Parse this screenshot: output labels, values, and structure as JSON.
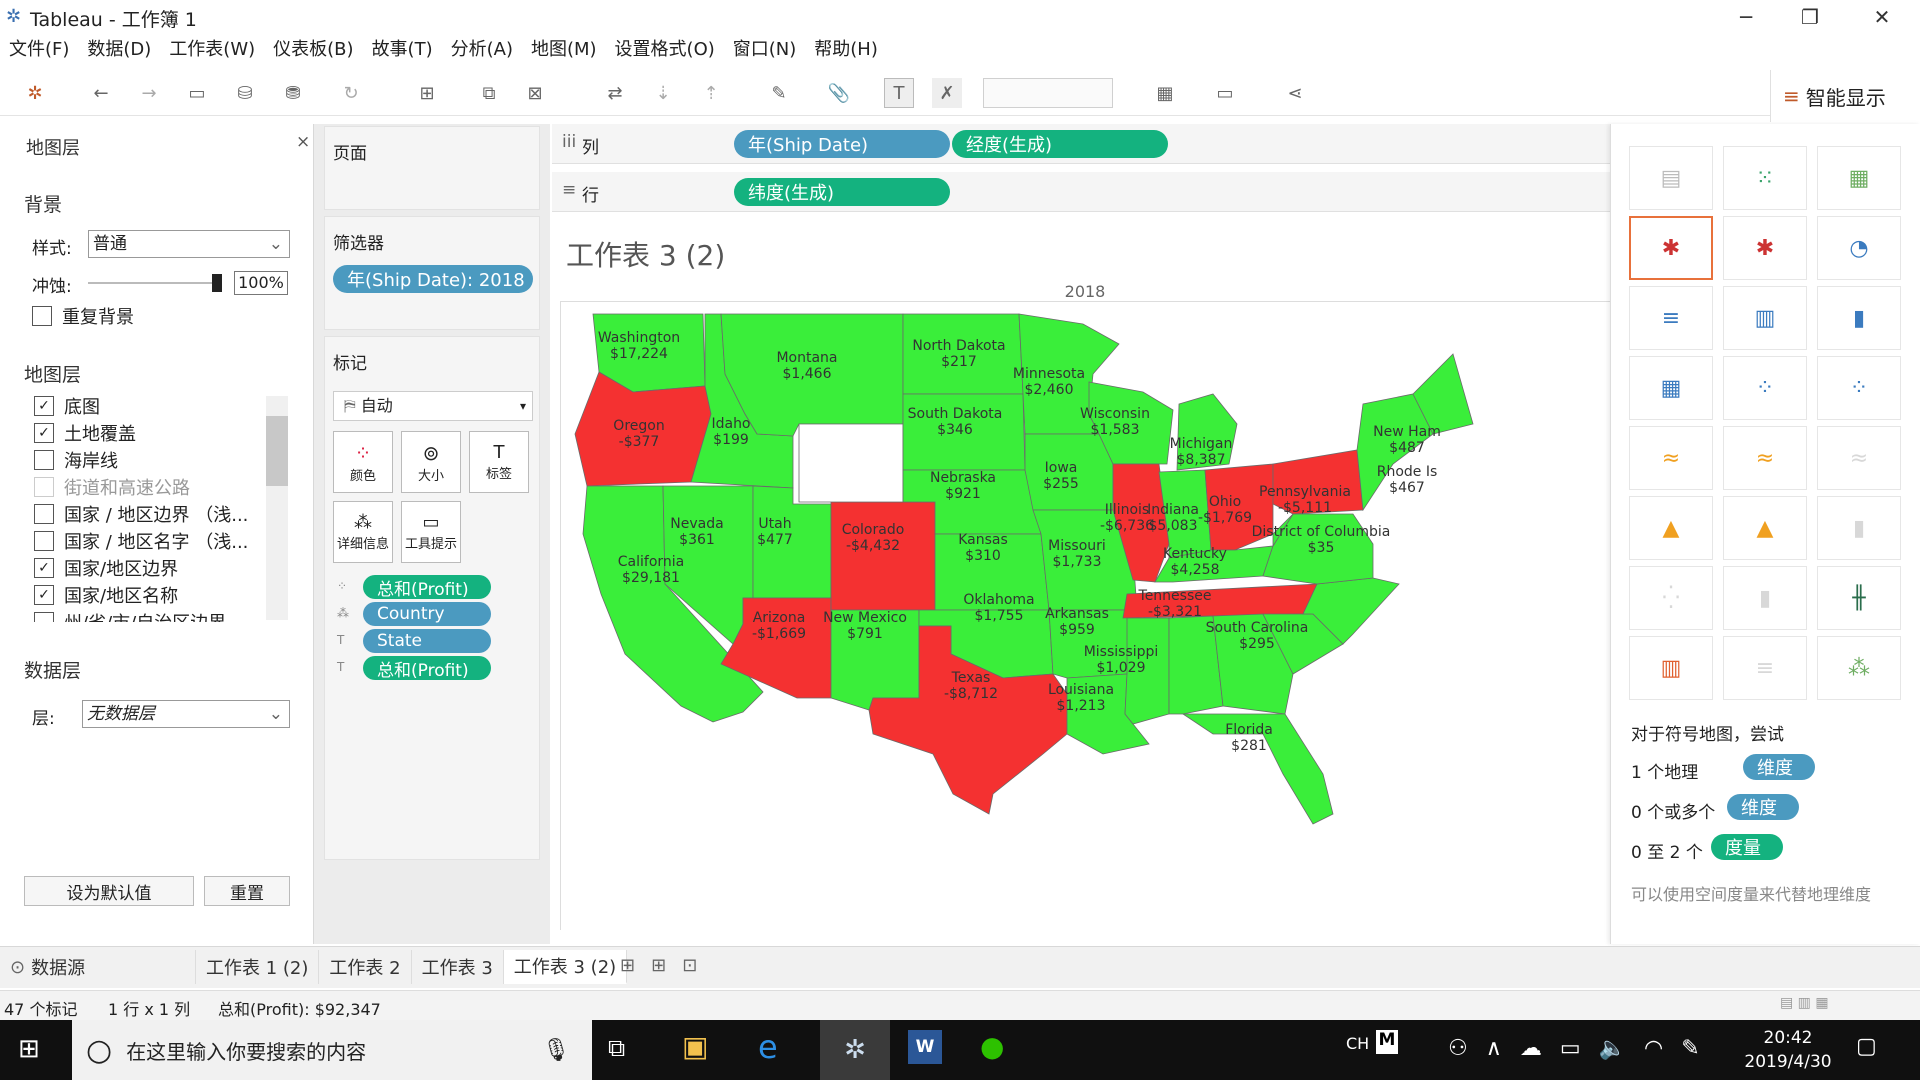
{
  "window": {
    "title": "Tableau - 工作簿 1"
  },
  "menu": [
    "文件(F)",
    "数据(D)",
    "工作表(W)",
    "仪表板(B)",
    "故事(T)",
    "分析(A)",
    "地图(M)",
    "设置格式(O)",
    "窗口(N)",
    "帮助(H)"
  ],
  "smart_show": {
    "label": "智能显示",
    "hint_title": "对于符号地图，尝试",
    "req1_text": "1 个地理",
    "req1_pill": "维度",
    "req2_text": "0 个或多个",
    "req2_pill": "维度",
    "req3_text": "0 至 2 个",
    "req3_pill": "度量",
    "note": "可以使用空间度量来代替地理维度"
  },
  "map_layers": {
    "title": "地图层",
    "background_heading": "背景",
    "style_label": "样式:",
    "style_value": "普通",
    "wash_label": "冲蚀:",
    "wash_value": "100%",
    "repeat_label": "重复背景",
    "layers_heading": "地图层",
    "layers": [
      {
        "label": "底图",
        "checked": true,
        "disabled": false
      },
      {
        "label": "土地覆盖",
        "checked": true,
        "disabled": false
      },
      {
        "label": "海岸线",
        "checked": false,
        "disabled": false
      },
      {
        "label": "街道和高速公路",
        "checked": false,
        "disabled": true
      },
      {
        "label": "国家 / 地区边界 （浅...",
        "checked": false,
        "disabled": false
      },
      {
        "label": "国家 / 地区名字 （浅...",
        "checked": false,
        "disabled": false
      },
      {
        "label": "国家/地区边界",
        "checked": true,
        "disabled": false
      },
      {
        "label": "国家/地区名称",
        "checked": true,
        "disabled": false
      },
      {
        "label": "州/省/市/自治区边界",
        "checked": false,
        "disabled": false
      }
    ],
    "data_layer_heading": "数据层",
    "layer_label": "层:",
    "layer_value": "无数据层",
    "set_default": "设为默认值",
    "reset": "重置"
  },
  "pages": {
    "title": "页面"
  },
  "filters": {
    "title": "筛选器",
    "pill": "年(Ship Date): 2018"
  },
  "marks": {
    "title": "标记",
    "type": "自动",
    "btn_color": "颜色",
    "btn_size": "大小",
    "btn_label": "标签",
    "btn_detail": "详细信息",
    "btn_tooltip": "工具提示",
    "pills": [
      {
        "label": "总和(Profit)",
        "color": "#14b27f"
      },
      {
        "label": "Country",
        "color": "#4b9ac0"
      },
      {
        "label": "State",
        "color": "#4b9ac0"
      },
      {
        "label": "总和(Profit)",
        "color": "#14b27f"
      }
    ]
  },
  "columns": {
    "label": "列",
    "pills": [
      "年(Ship Date)",
      "经度(生成)"
    ]
  },
  "rows": {
    "label": "行",
    "pills": [
      "纬度(生成)"
    ]
  },
  "sheet": {
    "title": "工作表 3 (2)",
    "header": "2018"
  },
  "colors": {
    "profit": "#3aee3a",
    "loss": "#f43131"
  },
  "states": [
    {
      "name": "Washington",
      "value": "$17,224",
      "profit": true
    },
    {
      "name": "Oregon",
      "value": "-$377",
      "profit": false
    },
    {
      "name": "California",
      "value": "$29,181",
      "profit": true
    },
    {
      "name": "Nevada",
      "value": "$361",
      "profit": true
    },
    {
      "name": "Idaho",
      "value": "$199",
      "profit": true
    },
    {
      "name": "Montana",
      "value": "$1,466",
      "profit": true
    },
    {
      "name": "Utah",
      "value": "$477",
      "profit": true
    },
    {
      "name": "Arizona",
      "value": "-$1,669",
      "profit": false
    },
    {
      "name": "Colorado",
      "value": "-$4,432",
      "profit": false
    },
    {
      "name": "New Mexico",
      "value": "$791",
      "profit": true
    },
    {
      "name": "North Dakota",
      "value": "$217",
      "profit": true
    },
    {
      "name": "South Dakota",
      "value": "$346",
      "profit": true
    },
    {
      "name": "Nebraska",
      "value": "$921",
      "profit": true
    },
    {
      "name": "Kansas",
      "value": "$310",
      "profit": true
    },
    {
      "name": "Oklahoma",
      "value": "$1,755",
      "profit": true
    },
    {
      "name": "Texas",
      "value": "-$8,712",
      "profit": false
    },
    {
      "name": "Minnesota",
      "value": "$2,460",
      "profit": true
    },
    {
      "name": "Iowa",
      "value": "$255",
      "profit": true
    },
    {
      "name": "Missouri",
      "value": "$1,733",
      "profit": true
    },
    {
      "name": "Arkansas",
      "value": "$959",
      "profit": true
    },
    {
      "name": "Louisiana",
      "value": "$1,213",
      "profit": true
    },
    {
      "name": "Wisconsin",
      "value": "$1,583",
      "profit": true
    },
    {
      "name": "Illinois",
      "value": "-$6,736",
      "profit": false
    },
    {
      "name": "Mississippi",
      "value": "$1,029",
      "profit": true
    },
    {
      "name": "Michigan",
      "value": "$8,387",
      "profit": true
    },
    {
      "name": "Indiana",
      "value": "$5,083",
      "profit": true
    },
    {
      "name": "Kentucky",
      "value": "$4,258",
      "profit": true
    },
    {
      "name": "Tennessee",
      "value": "-$3,321",
      "profit": false
    },
    {
      "name": "Ohio",
      "value": "-$1,769",
      "profit": false
    },
    {
      "name": "Pennsylvania",
      "value": "-$5,111",
      "profit": false
    },
    {
      "name": "District of Columbia",
      "value": "$35",
      "profit": true
    },
    {
      "name": "South Carolina",
      "value": "$295",
      "profit": true
    },
    {
      "name": "Florida",
      "value": "$281",
      "profit": true
    },
    {
      "name": "New Ham",
      "value": "$487",
      "profit": true
    },
    {
      "name": "Rhode Is",
      "value": "$467",
      "profit": true
    }
  ],
  "tabs": {
    "datasource": "数据源",
    "sheets": [
      "工作表 1 (2)",
      "工作表 2",
      "工作表 3",
      "工作表 3 (2)"
    ],
    "active": 3
  },
  "status": {
    "marks": "47 个标记",
    "dims": "1 行 x 1 列",
    "sum": "总和(Profit): $92,347"
  },
  "taskbar": {
    "search_placeholder": "在这里输入你要搜索的内容",
    "ime": "CH",
    "time": "20:42",
    "date": "2019/4/30"
  }
}
